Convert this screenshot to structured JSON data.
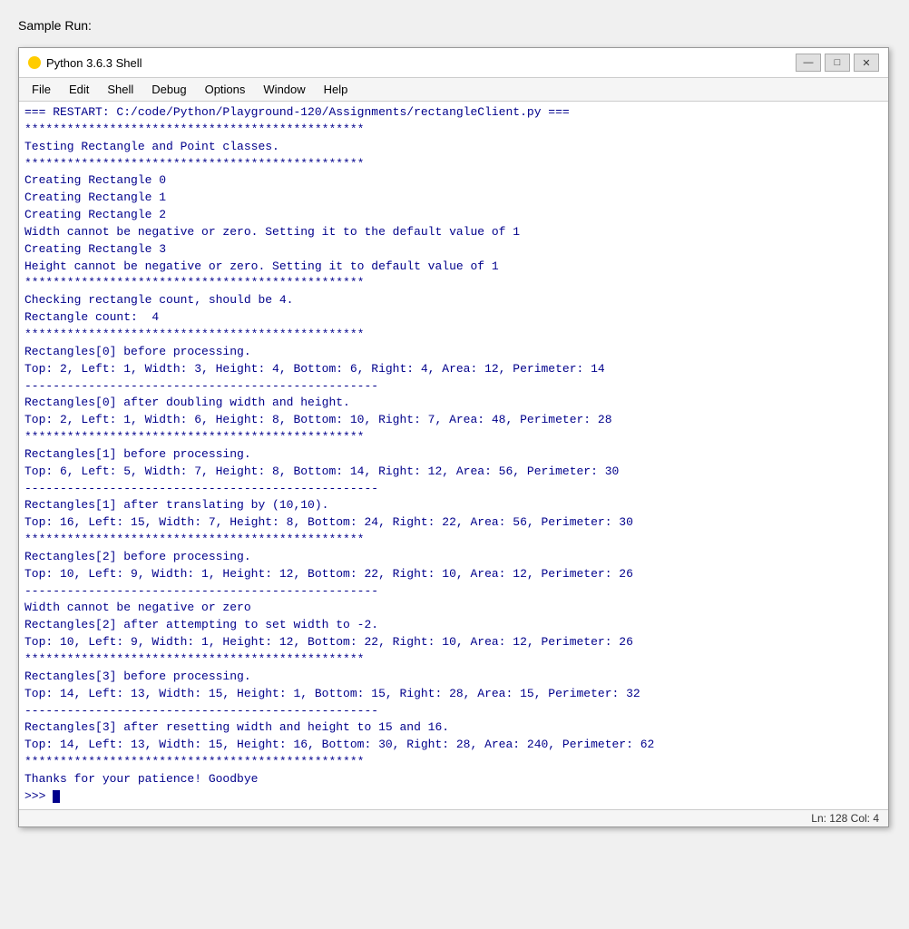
{
  "page": {
    "label": "Sample Run:"
  },
  "window": {
    "title": "Python 3.6.3 Shell",
    "minimize_label": "—",
    "maximize_label": "□",
    "close_label": "✕"
  },
  "menu": {
    "items": [
      "File",
      "Edit",
      "Shell",
      "Debug",
      "Options",
      "Window",
      "Help"
    ]
  },
  "shell": {
    "content": "=== RESTART: C:/code/Python/Playground-120/Assignments/rectangleClient.py ===\n************************************************\nTesting Rectangle and Point classes.\n************************************************\nCreating Rectangle 0\nCreating Rectangle 1\nCreating Rectangle 2\nWidth cannot be negative or zero. Setting it to the default value of 1\nCreating Rectangle 3\nHeight cannot be negative or zero. Setting it to default value of 1\n************************************************\nChecking rectangle count, should be 4.\nRectangle count:  4\n************************************************\nRectangles[0] before processing.\nTop: 2, Left: 1, Width: 3, Height: 4, Bottom: 6, Right: 4, Area: 12, Perimeter: 14\n--------------------------------------------------\nRectangles[0] after doubling width and height.\nTop: 2, Left: 1, Width: 6, Height: 8, Bottom: 10, Right: 7, Area: 48, Perimeter: 28\n************************************************\nRectangles[1] before processing.\nTop: 6, Left: 5, Width: 7, Height: 8, Bottom: 14, Right: 12, Area: 56, Perimeter: 30\n--------------------------------------------------\nRectangles[1] after translating by (10,10).\nTop: 16, Left: 15, Width: 7, Height: 8, Bottom: 24, Right: 22, Area: 56, Perimeter: 30\n************************************************\nRectangles[2] before processing.\nTop: 10, Left: 9, Width: 1, Height: 12, Bottom: 22, Right: 10, Area: 12, Perimeter: 26\n--------------------------------------------------\nWidth cannot be negative or zero\nRectangles[2] after attempting to set width to -2.\nTop: 10, Left: 9, Width: 1, Height: 12, Bottom: 22, Right: 10, Area: 12, Perimeter: 26\n************************************************\nRectangles[3] before processing.\nTop: 14, Left: 13, Width: 15, Height: 1, Bottom: 15, Right: 28, Area: 15, Perimeter: 32\n--------------------------------------------------\nRectangles[3] after resetting width and height to 15 and 16.\nTop: 14, Left: 13, Width: 15, Height: 16, Bottom: 30, Right: 28, Area: 240, Perimeter: 62\n************************************************\nThanks for your patience! Goodbye\n>>> ",
    "cursor_text": ">>> "
  },
  "status_bar": {
    "text": "Ln: 128  Col: 4"
  }
}
